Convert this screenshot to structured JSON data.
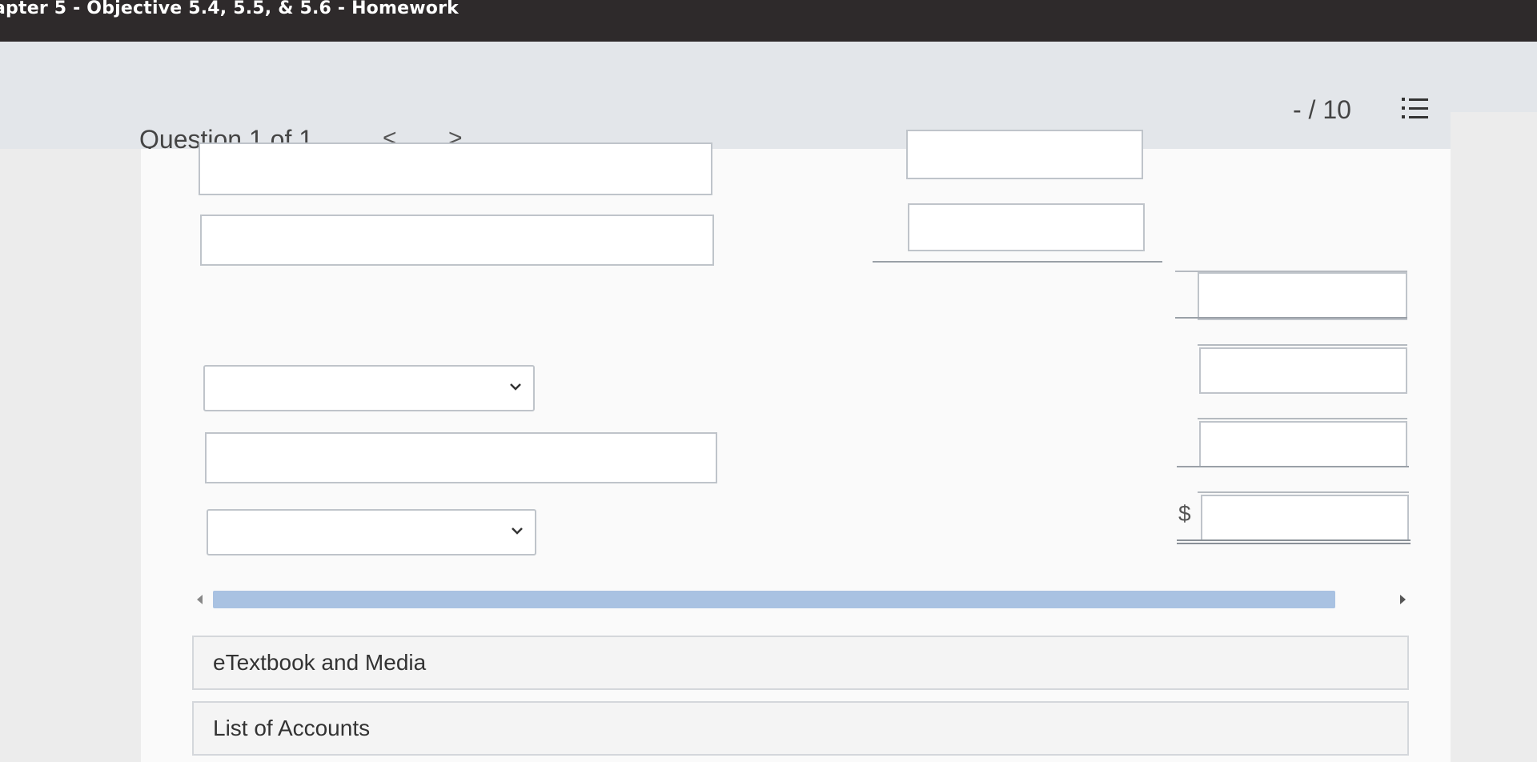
{
  "window": {
    "title": "apter 5 - Objective 5.4, 5.5, & 5.6 - Homework"
  },
  "question": {
    "label": "Question 1 of 1",
    "prev_label": "<",
    "next_label": ">",
    "score": "- / 10"
  },
  "form": {
    "currency_symbol": "$",
    "selects": [
      {
        "selected": ""
      },
      {
        "selected": ""
      }
    ],
    "inputs": [
      {
        "value": ""
      },
      {
        "value": ""
      },
      {
        "value": ""
      }
    ]
  },
  "sections": [
    {
      "label": "eTextbook and Media"
    },
    {
      "label": "List of Accounts"
    }
  ],
  "colors": {
    "title_bar": "#2e2a2b",
    "scroll_thumb": "#a9c2e2",
    "input_border": "#bfc4ca"
  }
}
